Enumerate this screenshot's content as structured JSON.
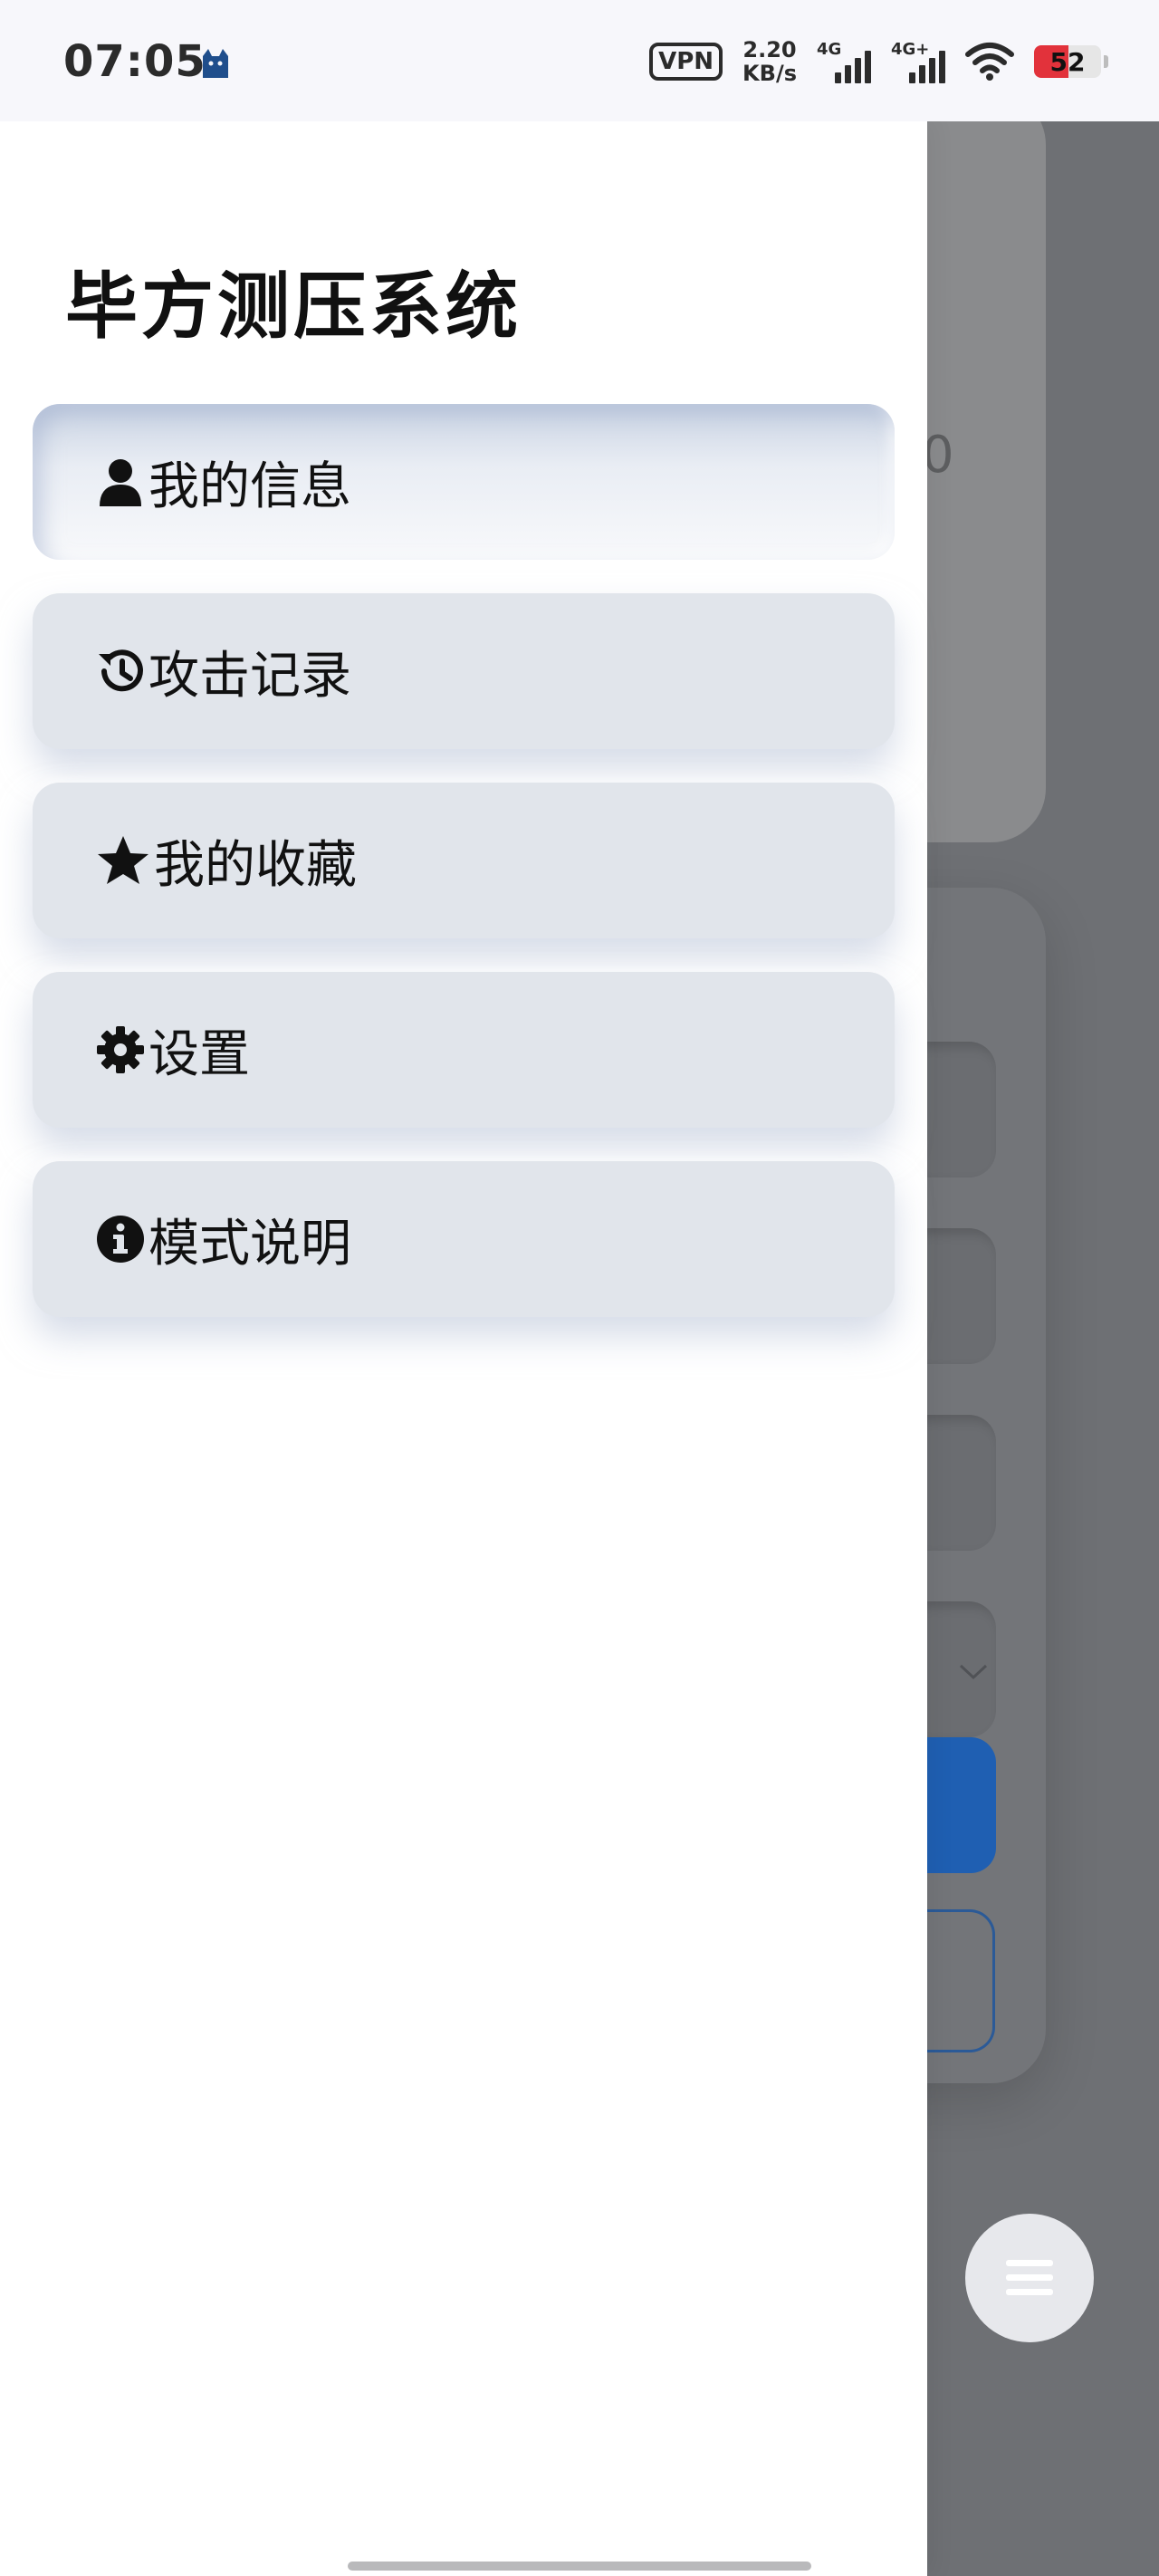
{
  "status_bar": {
    "time": "07:05",
    "app_icon": "cat-icon",
    "vpn": "VPN",
    "net_speed_value": "2.20",
    "net_speed_unit": "KB/s",
    "signal_1_tag": "4G",
    "signal_2_tag": "4G+",
    "wifi_icon": "wifi-icon",
    "battery_level": "52",
    "battery_color": "#e2323b"
  },
  "drawer": {
    "title": "毕方测压系统",
    "menu": [
      {
        "label": "我的信息",
        "icon": "user-icon",
        "active": true
      },
      {
        "label": "攻击记录",
        "icon": "history-icon",
        "active": false
      },
      {
        "label": "我的收藏",
        "icon": "star-icon",
        "active": false
      },
      {
        "label": "设置",
        "icon": "gear-icon",
        "active": false
      },
      {
        "label": "模式说明",
        "icon": "info-icon",
        "active": false
      }
    ]
  },
  "background_app": {
    "card_text_fragment": "0",
    "primary_button_color": "#1f5fb2",
    "fab_icon": "menu-icon"
  }
}
